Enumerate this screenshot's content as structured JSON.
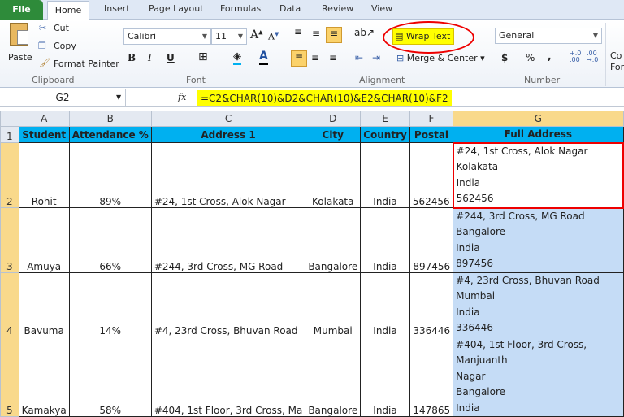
{
  "tabs": {
    "file": "File",
    "home": "Home",
    "items": [
      "Insert",
      "Page Layout",
      "Formulas",
      "Data",
      "Review",
      "View"
    ]
  },
  "clipboard": {
    "paste": "Paste",
    "cut": "Cut",
    "copy": "Copy",
    "format_painter": "Format Painter",
    "label": "Clipboard"
  },
  "font": {
    "name": "Calibri",
    "size": "11",
    "bold": "B",
    "italic": "I",
    "underline": "U",
    "label": "Font"
  },
  "alignment": {
    "wrap_text": "Wrap Text",
    "merge_center": "Merge & Center",
    "label": "Alignment"
  },
  "number": {
    "format": "General",
    "currency": "$",
    "percent": "%",
    "comma": ",",
    "label": "Number"
  },
  "styles": {
    "cond_format": "Co\nFor"
  },
  "formula_bar": {
    "name_box": "G2",
    "fx": "fx",
    "formula": "=C2&CHAR(10)&D2&CHAR(10)&E2&CHAR(10)&F2"
  },
  "grid": {
    "columns": [
      "A",
      "B",
      "C",
      "D",
      "E",
      "F",
      "G"
    ],
    "headers": [
      "Student",
      "Attendance %",
      "Address 1",
      "City",
      "Country",
      "Postal",
      "Full Address"
    ],
    "rows": [
      {
        "n": "2",
        "cells": [
          "Rohit",
          "89%",
          "#24, 1st Cross, Alok Nagar",
          "Kolakata",
          "India",
          "562456",
          "#24, 1st Cross, Alok Nagar\nKolakata\nIndia\n562456"
        ]
      },
      {
        "n": "3",
        "cells": [
          "Amuya",
          "66%",
          "#244, 3rd Cross, MG Road",
          "Bangalore",
          "India",
          "897456",
          "#244, 3rd Cross, MG Road\nBangalore\nIndia\n897456"
        ]
      },
      {
        "n": "4",
        "cells": [
          "Bavuma",
          "14%",
          "#4, 23rd Cross, Bhuvan Road",
          "Mumbai",
          "India",
          "336446",
          "#4, 23rd Cross, Bhuvan Road\nMumbai\nIndia\n336446"
        ]
      },
      {
        "n": "5",
        "cells": [
          "Kamakya",
          "58%",
          "#404, 1st Floor, 3rd Cross, Ma",
          "Bangalore",
          "India",
          "147865",
          "#404, 1st Floor, 3rd Cross, Manjuanth\nNagar\nBangalore\nIndia"
        ]
      }
    ]
  },
  "colors": {
    "header_fill": "#00b0f0",
    "selection": "#c5dcf6",
    "highlight": "#ffff00",
    "annotation": "#e00000"
  }
}
